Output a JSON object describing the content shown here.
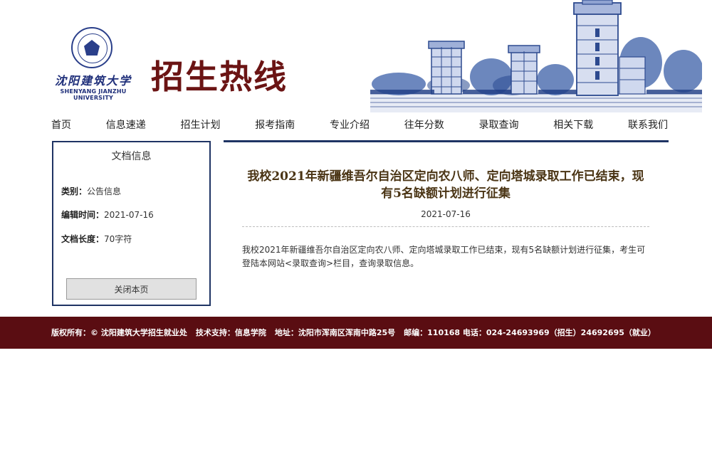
{
  "header": {
    "calligraphy": "沈阳建筑大学",
    "university_en": "SHENYANG JIANZHU UNIVERSITY",
    "site_title": "招生热线"
  },
  "nav": {
    "items": [
      "首页",
      "信息速递",
      "招生计划",
      "报考指南",
      "专业介绍",
      "往年分数",
      "录取查询",
      "相关下载",
      "联系我们"
    ]
  },
  "sidebar": {
    "title": "文档信息",
    "category_label": "类别：",
    "category_value": "公告信息",
    "edit_time_label": "编辑时间：",
    "edit_time_value": "2021-07-16",
    "length_label": "文档长度：",
    "length_value": "70字符",
    "close_button": "关闭本页"
  },
  "article": {
    "title": "我校2021年新疆维吾尔自治区定向农八师、定向塔城录取工作已结束，现有5名缺额计划进行征集",
    "date": "2021-07-16",
    "body": "我校2021年新疆维吾尔自治区定向农八师、定向塔城录取工作已结束，现有5名缺额计划进行征集，考生可登陆本网站<录取查询>栏目，查询录取信息。"
  },
  "footer": {
    "copyright": "版权所有：© 沈阳建筑大学招生就业处",
    "tech_support": "技术支持：信息学院",
    "address": "地址：沈阳市浑南区浑南中路25号",
    "contact": "邮编：110168 电话：024-24693969（招生）24692695（就业）"
  },
  "colors": {
    "brand_red": "#6b1414",
    "navy": "#1f3464",
    "footer_bg": "#5a0d12"
  }
}
